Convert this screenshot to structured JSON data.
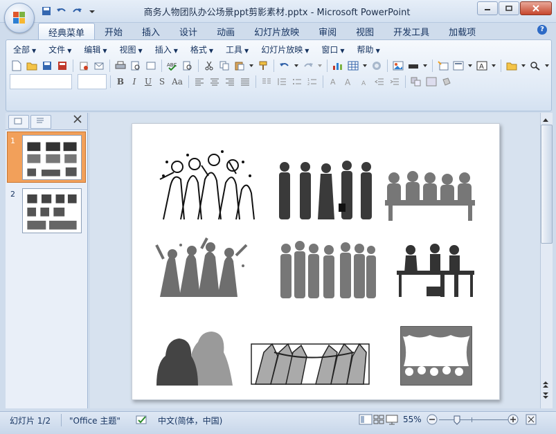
{
  "window": {
    "title": "商务人物团队办公场景ppt剪影素材.pptx - Microsoft PowerPoint"
  },
  "ribbon_tabs": [
    "经典菜单",
    "开始",
    "插入",
    "设计",
    "动画",
    "幻灯片放映",
    "审阅",
    "视图",
    "开发工具",
    "加载项"
  ],
  "classic_menu": [
    "全部",
    "文件",
    "编辑",
    "视图",
    "插入",
    "格式",
    "工具",
    "幻灯片放映",
    "窗口",
    "帮助"
  ],
  "format_buttons": {
    "bold": "B",
    "italic": "I",
    "underline": "U",
    "shadow": "S",
    "case": "Aa"
  },
  "icons": {
    "qat": [
      "save-icon",
      "undo-icon",
      "redo-icon",
      "customize-qat-icon"
    ],
    "toolbar": [
      "new-icon",
      "open-icon",
      "save-icon",
      "save-as-pdf-icon",
      "permission-icon",
      "print-icon",
      "print-preview-icon",
      "spell-check-icon",
      "research-icon",
      "cut-icon",
      "copy-icon",
      "paste-icon",
      "format-painter-icon",
      "undo-icon",
      "redo-icon",
      "chart-icon",
      "table-icon",
      "clipart-icon",
      "picture-icon",
      "shapes-icon"
    ]
  },
  "slides_pane": {
    "slides": [
      {
        "number": "1",
        "selected": true
      },
      {
        "number": "2",
        "selected": false
      }
    ]
  },
  "statusbar": {
    "slide_info": "幻灯片 1/2",
    "theme": "\"Office 主题\"",
    "language": "中文(简体，中国)",
    "zoom": "55%"
  },
  "colors": {
    "accent_selected_thumb": "#f2a05a",
    "silhouette_dark": "#4a4a4a",
    "silhouette_gray": "#777777"
  }
}
